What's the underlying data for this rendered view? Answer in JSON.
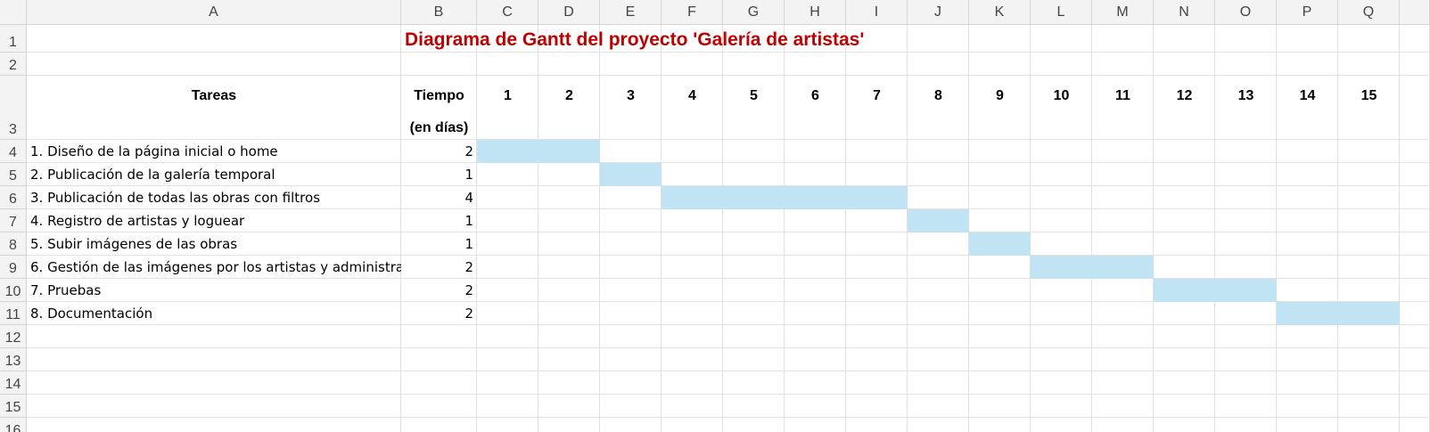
{
  "app": "Excel",
  "colors": {
    "bar": "#c1e4f5",
    "title": "#c00000",
    "grid": "#e1e1e1",
    "header_bg": "#f3f3f3"
  },
  "columns": [
    "A",
    "B",
    "C",
    "D",
    "E",
    "F",
    "G",
    "H",
    "I",
    "J",
    "K",
    "L",
    "M",
    "N",
    "O",
    "P",
    "Q"
  ],
  "rows": [
    "1",
    "2",
    "3",
    "4",
    "5",
    "6",
    "7",
    "8",
    "9",
    "10",
    "11",
    "12",
    "13",
    "14",
    "15",
    "16"
  ],
  "title": "Diagrama de Gantt del proyecto 'Galería de artistas'",
  "header": {
    "tasks": "Tareas",
    "time": "Tiempo",
    "time_unit": "(en días)",
    "days": [
      "1",
      "2",
      "3",
      "4",
      "5",
      "6",
      "7",
      "8",
      "9",
      "10",
      "11",
      "12",
      "13",
      "14",
      "15"
    ]
  },
  "tasks": [
    {
      "name": "1. Diseño de la página inicial o home",
      "days": 2,
      "start": 1
    },
    {
      "name": "2. Publicación de la galería temporal",
      "days": 1,
      "start": 3
    },
    {
      "name": "3. Publicación de todas las obras con filtros",
      "days": 4,
      "start": 4
    },
    {
      "name": "4. Registro de artistas y loguear",
      "days": 1,
      "start": 8
    },
    {
      "name": "5. Subir imágenes de las obras",
      "days": 1,
      "start": 9
    },
    {
      "name": "6. Gestión de las imágenes por los artistas y administra",
      "days": 2,
      "start": 10
    },
    {
      "name": "7. Pruebas",
      "days": 2,
      "start": 12
    },
    {
      "name": "8. Documentación",
      "days": 2,
      "start": 14
    }
  ]
}
